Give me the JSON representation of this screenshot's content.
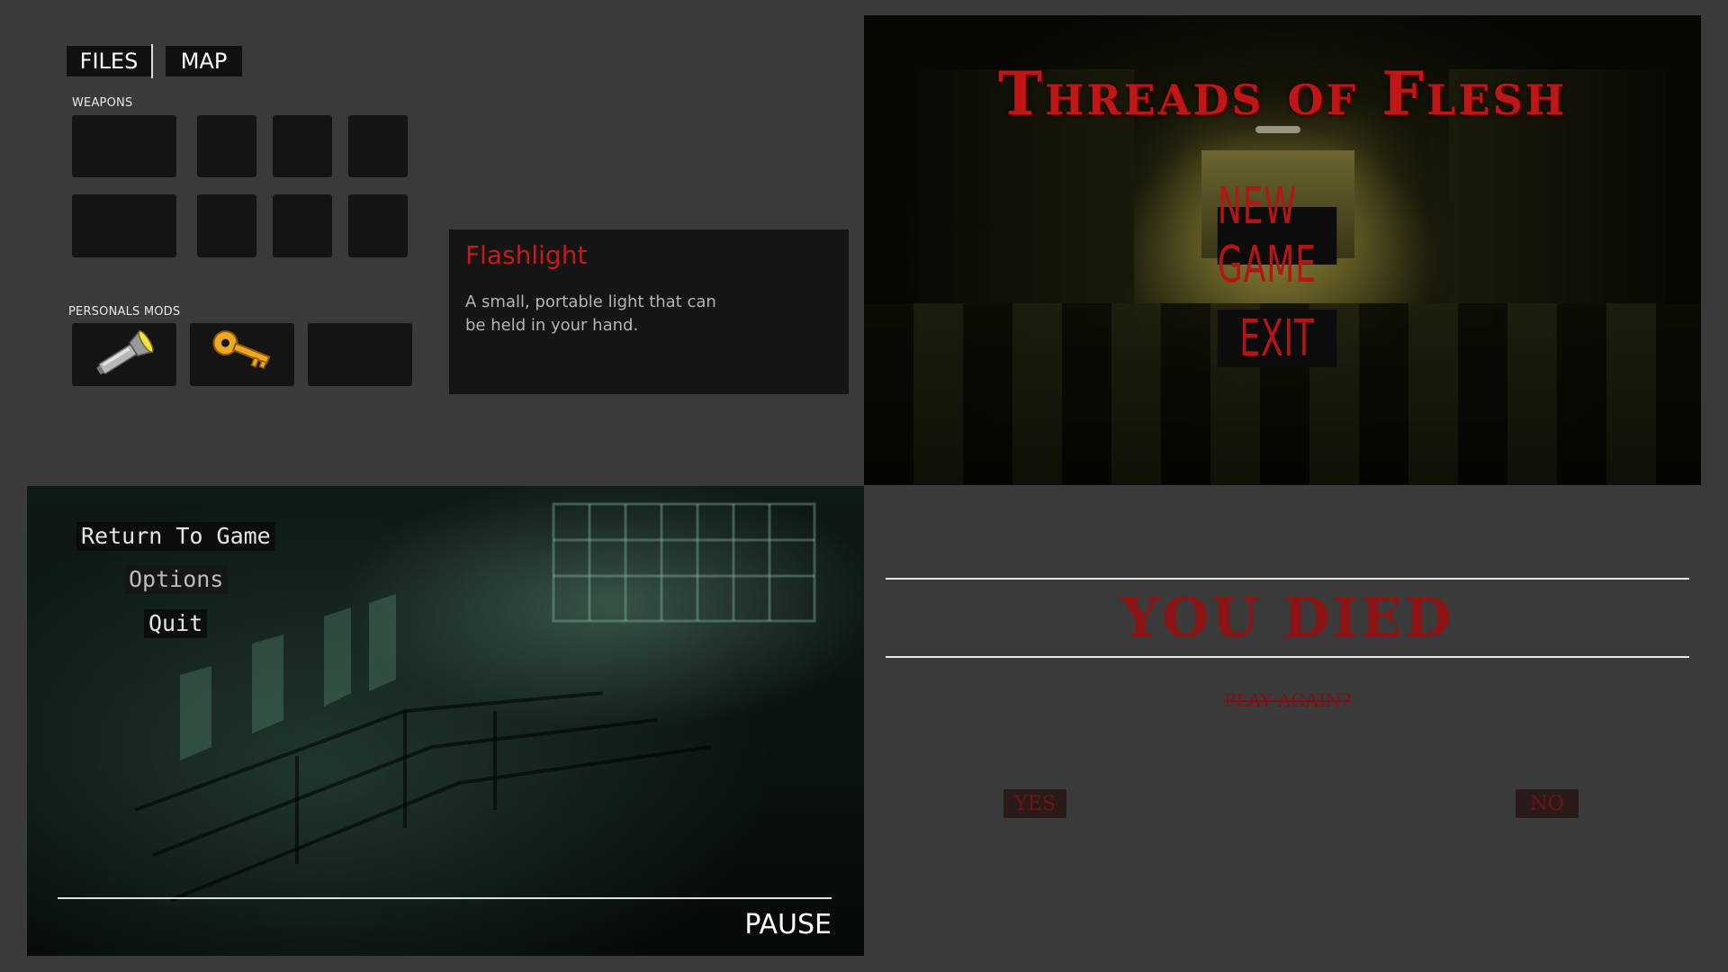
{
  "inventory": {
    "tabs": [
      "FILES",
      "MAP"
    ],
    "weapons_label": "WEAPONS",
    "mods_label": "PERSONALS MODS",
    "mod_items": [
      {
        "icon": "flashlight-icon"
      },
      {
        "icon": "key-icon"
      },
      {
        "icon": ""
      }
    ],
    "selected_item": {
      "title": "Flashlight",
      "description": "A small, portable light that can be held in your hand."
    },
    "colors": {
      "accent": "#c61a1a",
      "slot": "#141414",
      "panel": "#151515"
    }
  },
  "title_screen": {
    "game_title": "Threads of Flesh",
    "new_game": "NEW GAME",
    "exit": "EXIT",
    "colors": {
      "title": "#c11616",
      "button_text": "#b51515"
    }
  },
  "pause_screen": {
    "items": [
      "Return To Game",
      "Options",
      "Quit"
    ],
    "label": "PAUSE"
  },
  "death_screen": {
    "title": "YOU DIED",
    "prompt": "PLAY AGAIN?",
    "yes": "YES",
    "no": "NO",
    "colors": {
      "title": "#8c1414"
    }
  }
}
